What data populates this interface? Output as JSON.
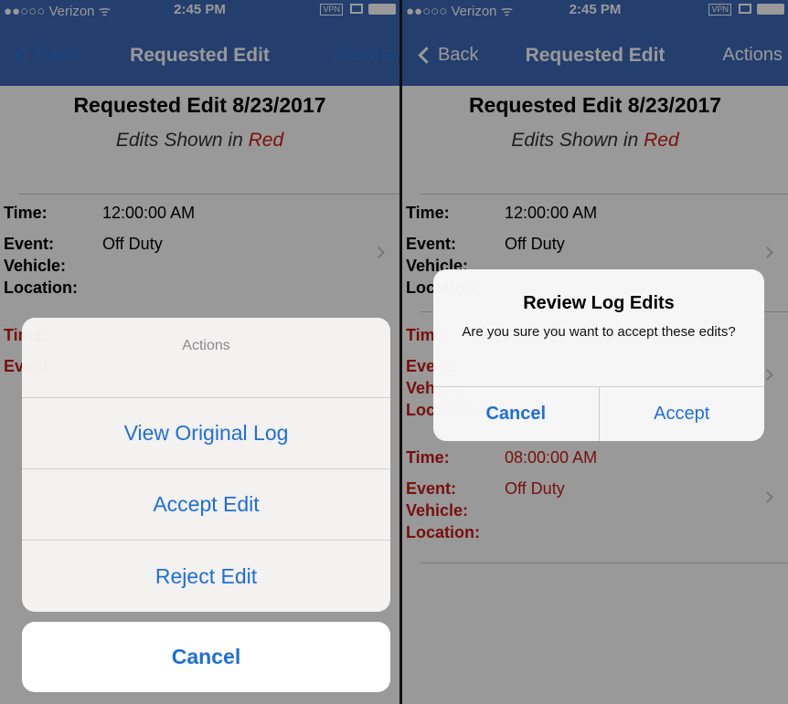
{
  "status_bar": {
    "carrier": "●●○○○ Verizon ᯤ",
    "time": "2:45 PM",
    "vpn": "VPN"
  },
  "nav": {
    "back_label": "Back",
    "title": "Requested Edit",
    "actions_label": "Actions"
  },
  "document": {
    "title": "Requested Edit 8/23/2017",
    "subtitle_prefix": "Edits Shown in",
    "subtitle_red": "Red"
  },
  "labels": {
    "time": "Time:",
    "event": "Event:",
    "vehicle": "Vehicle:",
    "location": "Location:"
  },
  "entries": [
    {
      "time": "12:00:00 AM",
      "event": "Off Duty",
      "vehicle": "",
      "location": "",
      "edited": false
    },
    {
      "time": "",
      "event": "",
      "vehicle": "",
      "location": "",
      "edited": true
    },
    {
      "time": "08:00:00 AM",
      "event": "Off Duty",
      "vehicle": "",
      "location": "",
      "edited": true
    }
  ],
  "action_sheet": {
    "title": "Actions",
    "options": [
      "View Original Log",
      "Accept Edit",
      "Reject Edit"
    ],
    "cancel_label": "Cancel"
  },
  "alert": {
    "title": "Review Log Edits",
    "message": "Are you sure you want to accept these edits?",
    "cancel_label": "Cancel",
    "accept_label": "Accept"
  },
  "colors": {
    "nav_bar": "#3c68b7",
    "ios_blue": "#1e6fd9",
    "edit_red": "#c81919"
  }
}
